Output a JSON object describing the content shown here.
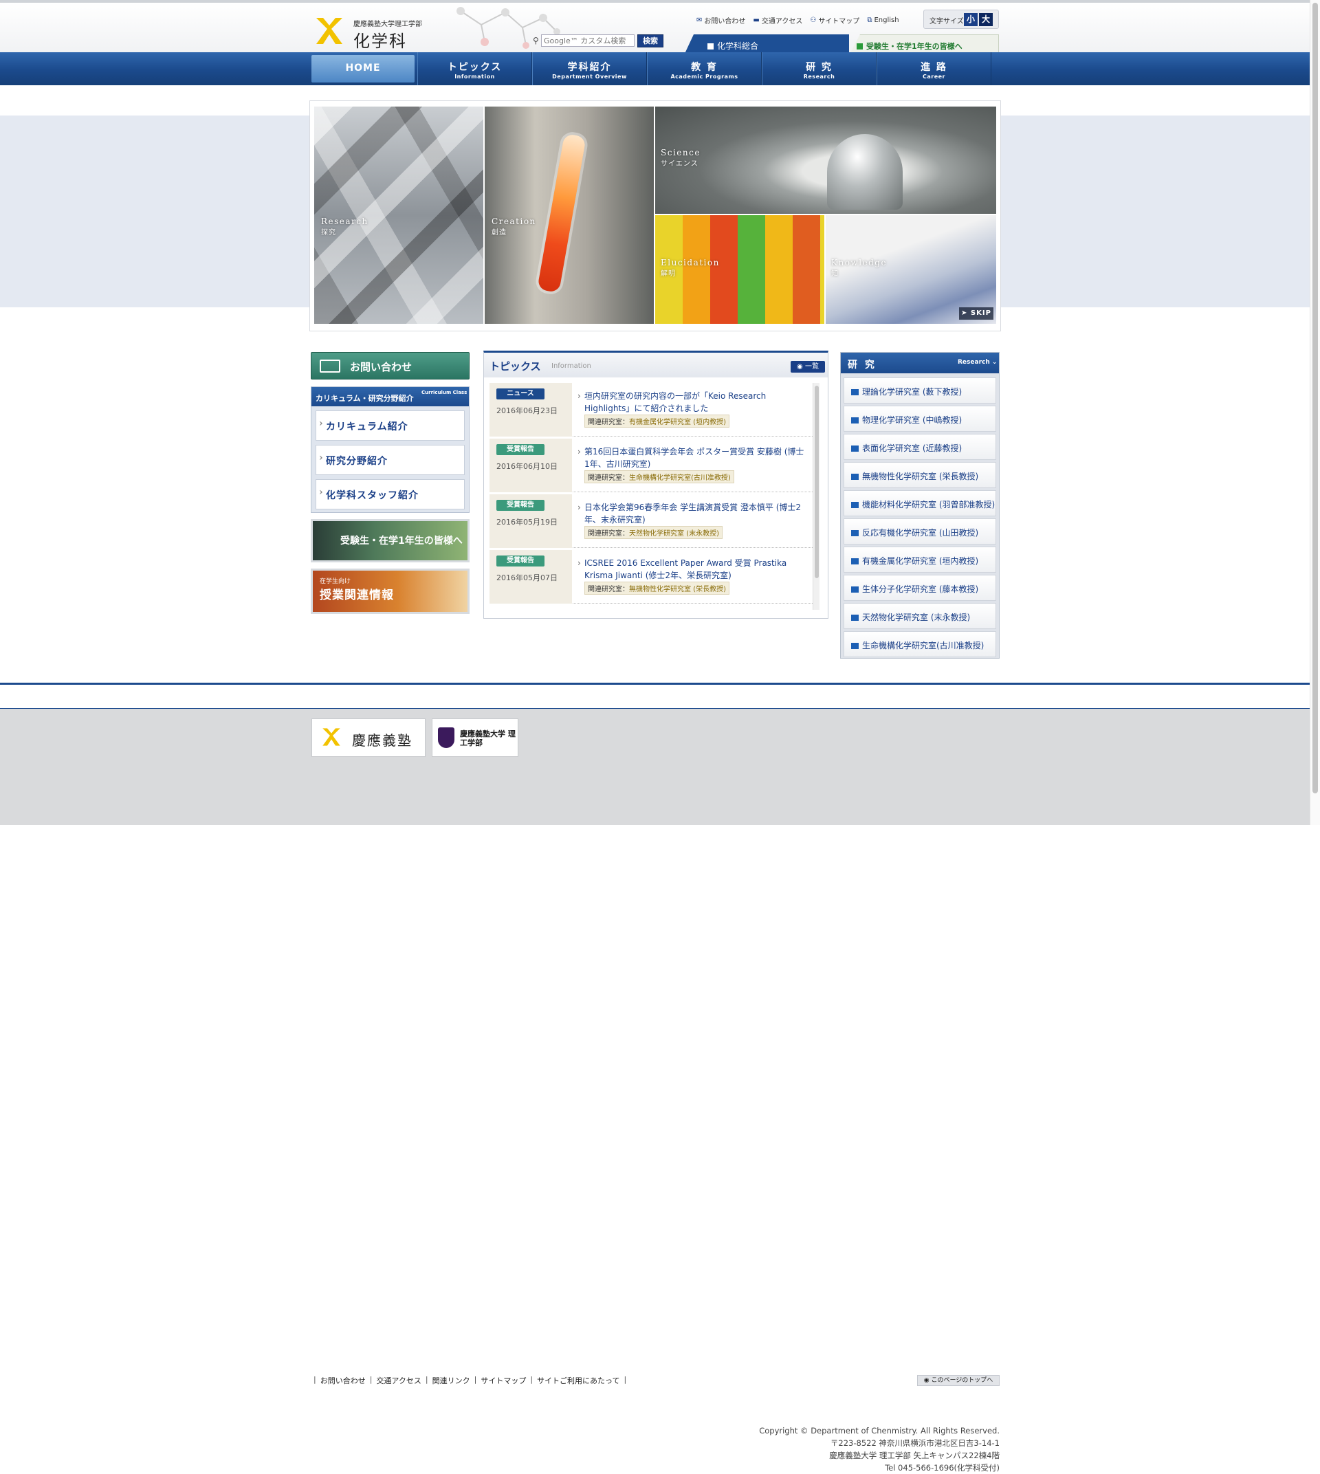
{
  "header": {
    "logo_univ": "慶應義塾大学理工学部",
    "logo_dept": "化学科",
    "search_placeholder": "Google™ カスタム検索",
    "search_button": "検索",
    "util_links": [
      {
        "label": "お問い合わせ",
        "icon": "mail-icon"
      },
      {
        "label": "交通アクセス",
        "icon": "car-icon"
      },
      {
        "label": "サイトマップ",
        "icon": "sitemap-icon"
      },
      {
        "label": "English",
        "icon": "globe-icon"
      }
    ],
    "font_size_label": "文字サイズ",
    "font_small": "小",
    "font_large": "大",
    "tab_overview": "化学科総合",
    "tab_applicants": "受験生・在学1年生の皆様へ"
  },
  "nav": [
    {
      "jp": "HOME",
      "en": ""
    },
    {
      "jp": "トピックス",
      "en": "Information"
    },
    {
      "jp": "学科紹介",
      "en": "Department Overview"
    },
    {
      "jp": "教 育",
      "en": "Academic Programs"
    },
    {
      "jp": "研 究",
      "en": "Research"
    },
    {
      "jp": "進 路",
      "en": "Career"
    }
  ],
  "hero": {
    "research": {
      "en": "Research",
      "jp": "探究"
    },
    "creation": {
      "en": "Creation",
      "jp": "創造"
    },
    "science": {
      "en": "Science",
      "jp": "サイエンス"
    },
    "elucidation": {
      "en": "Elucidation",
      "jp": "解明"
    },
    "knowledge": {
      "en": "Knowledge",
      "jp": "知"
    },
    "skip": "SKIP"
  },
  "left": {
    "contact": "お問い合わせ",
    "curriculum_head": "カリキュラム・研究分野紹介",
    "curriculum_head_en": "Curriculum Class",
    "items": [
      "カリキュラム紹介",
      "研究分野紹介",
      "化学科スタッフ紹介"
    ],
    "banner_applicants": "受験生・在学1年生の皆様へ",
    "banner_classes_small": "在学生向け",
    "banner_classes": "授業関連情報"
  },
  "topics": {
    "title": "トピックス",
    "title_en": "Information",
    "all": "一覧",
    "items": [
      {
        "badge": "ニュース",
        "badge_color": "#1c4a8d",
        "date": "2016年06月23日",
        "title": "垣内研究室の研究内容の一部が「Keio Research Highlights」にて紹介されました",
        "lab_label": "関連研究室：",
        "lab": "有機金属化学研究室 (垣内教授)"
      },
      {
        "badge": "受賞報告",
        "badge_color": "#3b9a7c",
        "date": "2016年06月10日",
        "title": "第16回日本蛋白質科学会年会 ポスター賞受賞 安藤樹 (博士1年、古川研究室)",
        "lab_label": "関連研究室：",
        "lab": "生命機構化学研究室(古川准教授)"
      },
      {
        "badge": "受賞報告",
        "badge_color": "#3b9a7c",
        "date": "2016年05月19日",
        "title": "日本化学会第96春季年会 学生講演賞受賞 澄本慎平 (博士2年、末永研究室)",
        "lab_label": "関連研究室：",
        "lab": "天然物化学研究室 (末永教授)"
      },
      {
        "badge": "受賞報告",
        "badge_color": "#3b9a7c",
        "date": "2016年05月07日",
        "title": "ICSREE 2016 Excellent Paper Award 受賞 Prastika Krisma Jiwanti (修士2年、栄長研究室)",
        "lab_label": "関連研究室：",
        "lab": "無機物性化学研究室 (栄長教授)"
      }
    ]
  },
  "research": {
    "title": "研 究",
    "title_en": "Research",
    "labs": [
      "理論化学研究室 (藪下教授)",
      "物理化学研究室 (中嶋教授)",
      "表面化学研究室 (近藤教授)",
      "無機物性化学研究室 (栄長教授)",
      "機能材料化学研究室 (羽曾部准教授)",
      "反応有機化学研究室 (山田教授)",
      "有機金属化学研究室 (垣内教授)",
      "生体分子化学研究室 (藤本教授)",
      "天然物化学研究室 (末永教授)",
      "生命機構化学研究室(古川准教授)"
    ]
  },
  "footer": {
    "links": [
      "お問い合わせ",
      "交通アクセス",
      "関連リンク",
      "サイトマップ",
      "サイトご利用にあたって"
    ],
    "pagetop": "このページのトップへ",
    "logo_keio": "慶應義塾",
    "logo_st": "慶應義塾大学 理工学部",
    "copyright": "Copyright © Department of Chenmistry. All Rights Reserved.",
    "address": "〒223-8522 神奈川県横浜市港北区日吉3-14-1",
    "building": "慶應義塾大学 理工学部 矢上キャンパス22棟4階",
    "tel": "Tel 045-566-1696(化学科受付)"
  },
  "colors": {
    "navy": "#1c4a8d",
    "green": "#3b9a7c",
    "accent_yellow": "#f2c200"
  }
}
